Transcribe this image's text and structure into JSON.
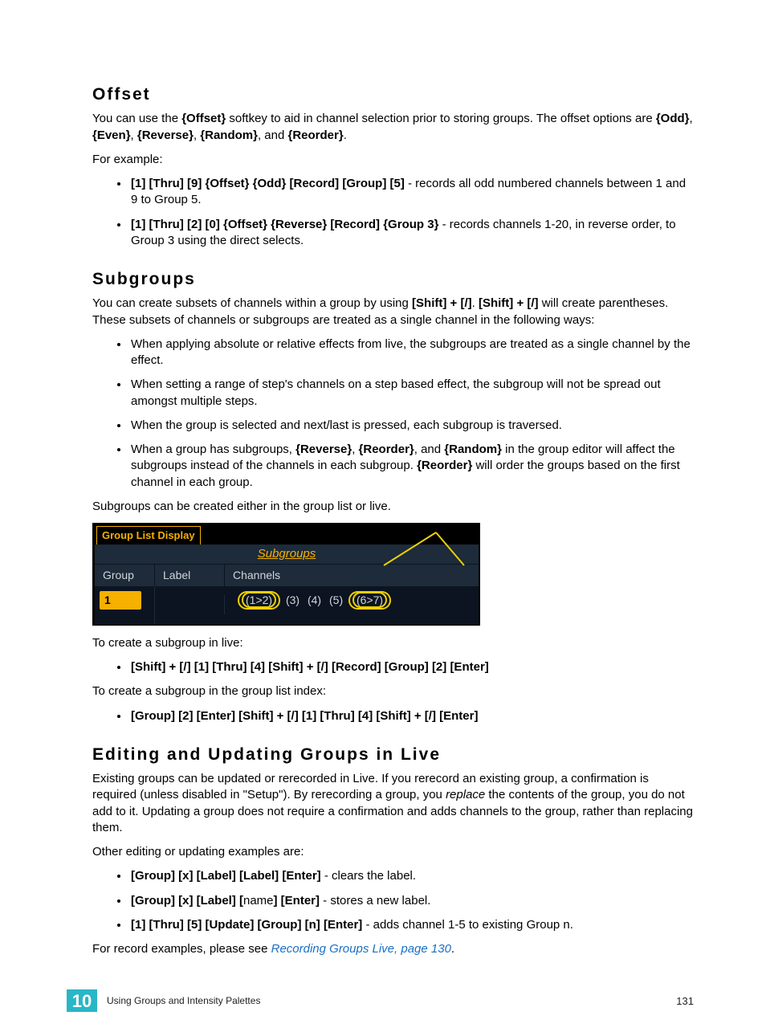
{
  "offset": {
    "heading": "Offset",
    "p1a": "You can use the ",
    "p1b": "{Offset}",
    "p1c": " softkey to aid in channel selection prior to storing groups. The offset options are ",
    "p1d": "{Odd}",
    "p1e": ", ",
    "p1f": "{Even}",
    "p1g": ", ",
    "p1h": "{Reverse}",
    "p1i": ", ",
    "p1j": "{Random}",
    "p1k": ", and ",
    "p1l": "{Reorder}",
    "p1m": ".",
    "p2": "For example:",
    "li1a": "[1] [Thru] [9] {Offset} {Odd} [Record] [Group] [5]",
    "li1b": " - records all odd numbered channels between 1 and 9 to Group 5.",
    "li2a": "[1] [Thru] [2] [0] {Offset} {Reverse} [Record] {Group 3}",
    "li2b": " - records channels 1-20, in reverse order, to Group 3 using the direct selects."
  },
  "subgroups": {
    "heading": "Subgroups",
    "p1a": "You can create subsets of channels within a group by using ",
    "p1b": "[Shift] + [/]",
    "p1c": ". ",
    "p1d": "[Shift] + [/]",
    "p1e": " will create parentheses. These subsets of channels or subgroups are treated as a single channel in the following ways:",
    "li1": "When applying absolute or relative effects from live, the subgroups are treated as a single channel by the effect.",
    "li2": "When setting a range of step's channels on a step based effect, the subgroup will not be spread out amongst multiple steps.",
    "li3": "When the group is selected and next/last is pressed, each subgroup is traversed.",
    "li4a": "When a group has subgroups, ",
    "li4b": "{Reverse}",
    "li4c": ", ",
    "li4d": "{Reorder}",
    "li4e": ", and ",
    "li4f": "{Random}",
    "li4g": " in the group editor will affect the subgroups instead of the channels in each subgroup. ",
    "li4h": "{Reorder}",
    "li4i": " will order the groups based on the first channel in each group.",
    "p2": "Subgroups can be created either in the group list or live."
  },
  "gld": {
    "tab": "Group List Display",
    "subhead": "Subgroups",
    "col_group": "Group",
    "col_label": "Label",
    "col_channels": "Channels",
    "gnum": "1",
    "ch1": "(1>2)",
    "ch2": "(3)",
    "ch3": "(4)",
    "ch4": "(5)",
    "ch5": "(6>7)"
  },
  "after": {
    "p1": "To create a subgroup in live:",
    "li1": "[Shift] + [/] [1] [Thru] [4] [Shift] + [/] [Record] [Group] [2] [Enter]",
    "p2": "To create a subgroup in the group list index:",
    "li2": "[Group] [2] [Enter] [Shift] + [/] [1] [Thru] [4] [Shift] + [/] [Enter]"
  },
  "editing": {
    "heading": "Editing and Updating Groups in Live",
    "p1a": "Existing groups can be updated or rerecorded in Live. If you rerecord an existing group, a confirmation is required (unless disabled in \"Setup\"). By rerecording a group, you ",
    "p1b": "replace",
    "p1c": " the contents of the group, you do not add to it. Updating a group does not require a confirmation and adds channels to the group, rather than replacing them.",
    "p2": "Other editing or updating examples are:",
    "li1a": "[Group] [x] [Label] [Label] [Enter]",
    "li1b": " - clears the label.",
    "li2a": "[Group] [x] [Label] [",
    "li2b": "name",
    "li2c": "] [Enter]",
    "li2d": " - stores a new label.",
    "li3a": "[1] [Thru] [5] [Update] [Group] [n] [Enter]",
    "li3b": " - adds channel 1-5 to existing Group n.",
    "p3a": "For record examples, please see ",
    "p3b": "Recording Groups Live, page 130",
    "p3c": "."
  },
  "footer": {
    "chapter": "10",
    "section": "Using Groups and Intensity Palettes",
    "page": "131"
  }
}
